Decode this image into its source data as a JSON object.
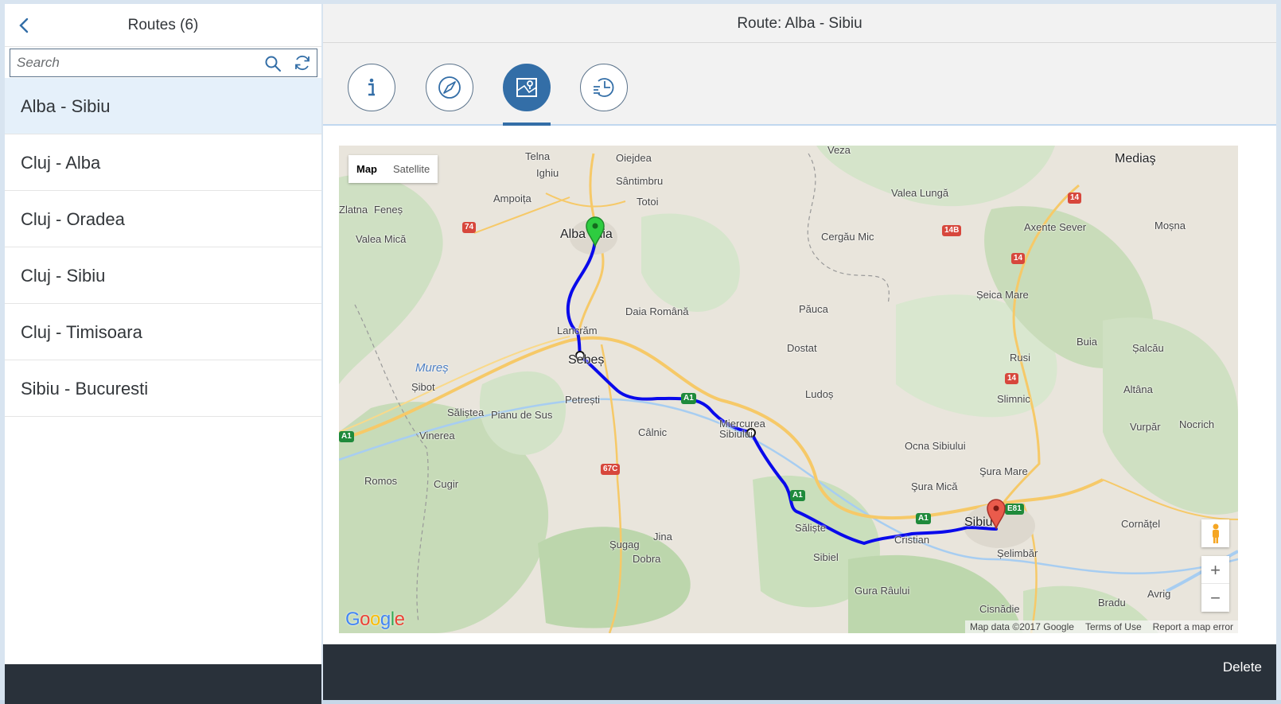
{
  "master": {
    "title": "Routes (6)",
    "search_placeholder": "Search",
    "routes": [
      {
        "label": "Alba - Sibiu",
        "selected": true
      },
      {
        "label": "Cluj - Alba",
        "selected": false
      },
      {
        "label": "Cluj - Oradea",
        "selected": false
      },
      {
        "label": "Cluj - Sibiu",
        "selected": false
      },
      {
        "label": "Cluj - Timisoara",
        "selected": false
      },
      {
        "label": "Sibiu - Bucuresti",
        "selected": false
      }
    ]
  },
  "detail": {
    "title": "Route: Alba - Sibiu",
    "tabs": [
      {
        "icon": "info-icon",
        "active": false
      },
      {
        "icon": "compass-icon",
        "active": false
      },
      {
        "icon": "map-icon",
        "active": true
      },
      {
        "icon": "history-icon",
        "active": false
      }
    ],
    "delete_label": "Delete"
  },
  "map": {
    "type_buttons": {
      "map": "Map",
      "satellite": "Satellite"
    },
    "zoom_in": "+",
    "zoom_out": "−",
    "logo": "Google",
    "attribution": {
      "data": "Map data ©2017 Google",
      "terms": "Terms of Use",
      "report": "Report a map error"
    },
    "places": [
      {
        "name": "Telna"
      },
      {
        "name": "Oiejdea"
      },
      {
        "name": "Veza"
      },
      {
        "name": "Mediaş"
      },
      {
        "name": "Ighiu"
      },
      {
        "name": "Sântimbru"
      },
      {
        "name": "Ampoița"
      },
      {
        "name": "Totoi"
      },
      {
        "name": "Valea Lungă"
      },
      {
        "name": "Zlatna"
      },
      {
        "name": "Feneș"
      },
      {
        "name": "Alba Iulia"
      },
      {
        "name": "Axente Sever"
      },
      {
        "name": "Moșna"
      },
      {
        "name": "Valea Mică"
      },
      {
        "name": "Cergău Mic"
      },
      {
        "name": "Daia Română"
      },
      {
        "name": "Păuca"
      },
      {
        "name": "Șeica Mare"
      },
      {
        "name": "Lancrăm"
      },
      {
        "name": "Dostat"
      },
      {
        "name": "Buia"
      },
      {
        "name": "Șalcău"
      },
      {
        "name": "Sebeș"
      },
      {
        "name": "Rusi"
      },
      {
        "name": "Mureș"
      },
      {
        "name": "Șibot"
      },
      {
        "name": "Ludoș"
      },
      {
        "name": "Petrești"
      },
      {
        "name": "Slimnic"
      },
      {
        "name": "Altâna"
      },
      {
        "name": "Săliștea"
      },
      {
        "name": "Pianu de Sus"
      },
      {
        "name": "Miercurea Sibiului"
      },
      {
        "name": "Vurpăr"
      },
      {
        "name": "Nocrich"
      },
      {
        "name": "Vinerea"
      },
      {
        "name": "Câlnic"
      },
      {
        "name": "Ocna Sibiului"
      },
      {
        "name": "Şura Mare"
      },
      {
        "name": "Romos"
      },
      {
        "name": "Cugir"
      },
      {
        "name": "Şura Mică"
      },
      {
        "name": "Sibiu"
      },
      {
        "name": "Cornățel"
      },
      {
        "name": "Săliște"
      },
      {
        "name": "Jina"
      },
      {
        "name": "Cristian"
      },
      {
        "name": "Şugag"
      },
      {
        "name": "Dobra"
      },
      {
        "name": "Sibiel"
      },
      {
        "name": "Șelimbăr"
      },
      {
        "name": "Gura Râului"
      },
      {
        "name": "Avrig"
      },
      {
        "name": "Bradu"
      },
      {
        "name": "Cisnădie"
      }
    ],
    "road_shields": [
      {
        "label": "74",
        "color": "#d7473c"
      },
      {
        "label": "14",
        "color": "#d7473c"
      },
      {
        "label": "14B",
        "color": "#d7473c"
      },
      {
        "label": "14",
        "color": "#d7473c"
      },
      {
        "label": "14",
        "color": "#d7473c"
      },
      {
        "label": "A1",
        "color": "#1f8a3b"
      },
      {
        "label": "A1",
        "color": "#1f8a3b"
      },
      {
        "label": "67C",
        "color": "#d7473c"
      },
      {
        "label": "A1",
        "color": "#1f8a3b"
      },
      {
        "label": "A1",
        "color": "#1f8a3b"
      },
      {
        "label": "E81",
        "color": "#1f8a3b"
      }
    ]
  },
  "colors": {
    "accent": "#336ea7",
    "footer": "#29313a",
    "selected_row": "#e5f0fa",
    "route_line": "#0a0aeb",
    "start_marker": "#2ecc40",
    "end_marker": "#e74c3c"
  }
}
